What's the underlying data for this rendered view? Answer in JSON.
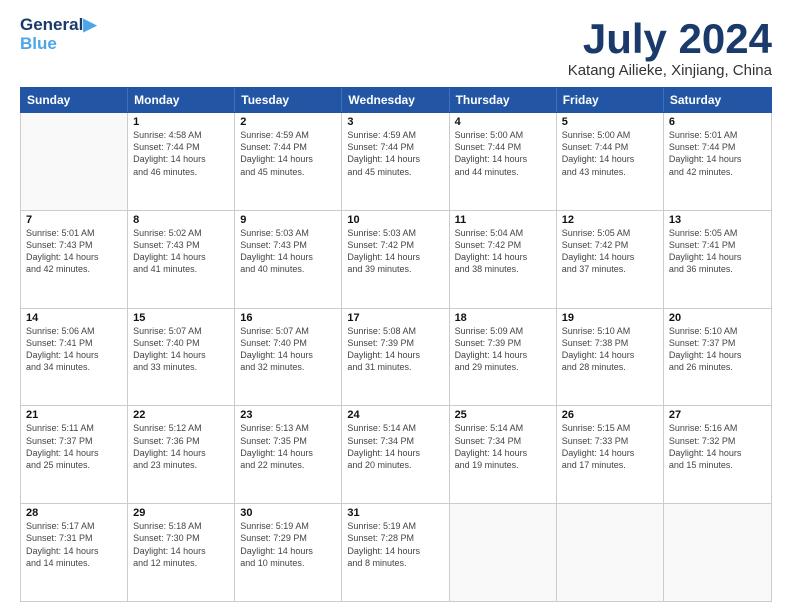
{
  "logo": {
    "line1": "General",
    "line2": "Blue",
    "bird": "🐦"
  },
  "title": "July 2024",
  "subtitle": "Katang Ailieke, Xinjiang, China",
  "header_days": [
    "Sunday",
    "Monday",
    "Tuesday",
    "Wednesday",
    "Thursday",
    "Friday",
    "Saturday"
  ],
  "weeks": [
    [
      {
        "day": "",
        "lines": []
      },
      {
        "day": "1",
        "lines": [
          "Sunrise: 4:58 AM",
          "Sunset: 7:44 PM",
          "Daylight: 14 hours",
          "and 46 minutes."
        ]
      },
      {
        "day": "2",
        "lines": [
          "Sunrise: 4:59 AM",
          "Sunset: 7:44 PM",
          "Daylight: 14 hours",
          "and 45 minutes."
        ]
      },
      {
        "day": "3",
        "lines": [
          "Sunrise: 4:59 AM",
          "Sunset: 7:44 PM",
          "Daylight: 14 hours",
          "and 45 minutes."
        ]
      },
      {
        "day": "4",
        "lines": [
          "Sunrise: 5:00 AM",
          "Sunset: 7:44 PM",
          "Daylight: 14 hours",
          "and 44 minutes."
        ]
      },
      {
        "day": "5",
        "lines": [
          "Sunrise: 5:00 AM",
          "Sunset: 7:44 PM",
          "Daylight: 14 hours",
          "and 43 minutes."
        ]
      },
      {
        "day": "6",
        "lines": [
          "Sunrise: 5:01 AM",
          "Sunset: 7:44 PM",
          "Daylight: 14 hours",
          "and 42 minutes."
        ]
      }
    ],
    [
      {
        "day": "7",
        "lines": [
          "Sunrise: 5:01 AM",
          "Sunset: 7:43 PM",
          "Daylight: 14 hours",
          "and 42 minutes."
        ]
      },
      {
        "day": "8",
        "lines": [
          "Sunrise: 5:02 AM",
          "Sunset: 7:43 PM",
          "Daylight: 14 hours",
          "and 41 minutes."
        ]
      },
      {
        "day": "9",
        "lines": [
          "Sunrise: 5:03 AM",
          "Sunset: 7:43 PM",
          "Daylight: 14 hours",
          "and 40 minutes."
        ]
      },
      {
        "day": "10",
        "lines": [
          "Sunrise: 5:03 AM",
          "Sunset: 7:42 PM",
          "Daylight: 14 hours",
          "and 39 minutes."
        ]
      },
      {
        "day": "11",
        "lines": [
          "Sunrise: 5:04 AM",
          "Sunset: 7:42 PM",
          "Daylight: 14 hours",
          "and 38 minutes."
        ]
      },
      {
        "day": "12",
        "lines": [
          "Sunrise: 5:05 AM",
          "Sunset: 7:42 PM",
          "Daylight: 14 hours",
          "and 37 minutes."
        ]
      },
      {
        "day": "13",
        "lines": [
          "Sunrise: 5:05 AM",
          "Sunset: 7:41 PM",
          "Daylight: 14 hours",
          "and 36 minutes."
        ]
      }
    ],
    [
      {
        "day": "14",
        "lines": [
          "Sunrise: 5:06 AM",
          "Sunset: 7:41 PM",
          "Daylight: 14 hours",
          "and 34 minutes."
        ]
      },
      {
        "day": "15",
        "lines": [
          "Sunrise: 5:07 AM",
          "Sunset: 7:40 PM",
          "Daylight: 14 hours",
          "and 33 minutes."
        ]
      },
      {
        "day": "16",
        "lines": [
          "Sunrise: 5:07 AM",
          "Sunset: 7:40 PM",
          "Daylight: 14 hours",
          "and 32 minutes."
        ]
      },
      {
        "day": "17",
        "lines": [
          "Sunrise: 5:08 AM",
          "Sunset: 7:39 PM",
          "Daylight: 14 hours",
          "and 31 minutes."
        ]
      },
      {
        "day": "18",
        "lines": [
          "Sunrise: 5:09 AM",
          "Sunset: 7:39 PM",
          "Daylight: 14 hours",
          "and 29 minutes."
        ]
      },
      {
        "day": "19",
        "lines": [
          "Sunrise: 5:10 AM",
          "Sunset: 7:38 PM",
          "Daylight: 14 hours",
          "and 28 minutes."
        ]
      },
      {
        "day": "20",
        "lines": [
          "Sunrise: 5:10 AM",
          "Sunset: 7:37 PM",
          "Daylight: 14 hours",
          "and 26 minutes."
        ]
      }
    ],
    [
      {
        "day": "21",
        "lines": [
          "Sunrise: 5:11 AM",
          "Sunset: 7:37 PM",
          "Daylight: 14 hours",
          "and 25 minutes."
        ]
      },
      {
        "day": "22",
        "lines": [
          "Sunrise: 5:12 AM",
          "Sunset: 7:36 PM",
          "Daylight: 14 hours",
          "and 23 minutes."
        ]
      },
      {
        "day": "23",
        "lines": [
          "Sunrise: 5:13 AM",
          "Sunset: 7:35 PM",
          "Daylight: 14 hours",
          "and 22 minutes."
        ]
      },
      {
        "day": "24",
        "lines": [
          "Sunrise: 5:14 AM",
          "Sunset: 7:34 PM",
          "Daylight: 14 hours",
          "and 20 minutes."
        ]
      },
      {
        "day": "25",
        "lines": [
          "Sunrise: 5:14 AM",
          "Sunset: 7:34 PM",
          "Daylight: 14 hours",
          "and 19 minutes."
        ]
      },
      {
        "day": "26",
        "lines": [
          "Sunrise: 5:15 AM",
          "Sunset: 7:33 PM",
          "Daylight: 14 hours",
          "and 17 minutes."
        ]
      },
      {
        "day": "27",
        "lines": [
          "Sunrise: 5:16 AM",
          "Sunset: 7:32 PM",
          "Daylight: 14 hours",
          "and 15 minutes."
        ]
      }
    ],
    [
      {
        "day": "28",
        "lines": [
          "Sunrise: 5:17 AM",
          "Sunset: 7:31 PM",
          "Daylight: 14 hours",
          "and 14 minutes."
        ]
      },
      {
        "day": "29",
        "lines": [
          "Sunrise: 5:18 AM",
          "Sunset: 7:30 PM",
          "Daylight: 14 hours",
          "and 12 minutes."
        ]
      },
      {
        "day": "30",
        "lines": [
          "Sunrise: 5:19 AM",
          "Sunset: 7:29 PM",
          "Daylight: 14 hours",
          "and 10 minutes."
        ]
      },
      {
        "day": "31",
        "lines": [
          "Sunrise: 5:19 AM",
          "Sunset: 7:28 PM",
          "Daylight: 14 hours",
          "and 8 minutes."
        ]
      },
      {
        "day": "",
        "lines": []
      },
      {
        "day": "",
        "lines": []
      },
      {
        "day": "",
        "lines": []
      }
    ]
  ]
}
